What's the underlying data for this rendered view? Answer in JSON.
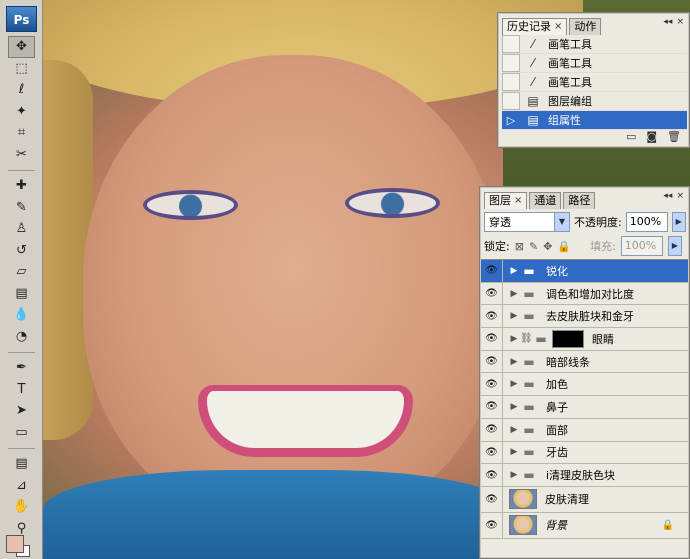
{
  "app": {
    "logo": "Ps"
  },
  "toolbar": {
    "tools": [
      {
        "name": "move-tool",
        "glyph": "✥",
        "selected": true
      },
      {
        "name": "marquee-tool",
        "glyph": "⬚"
      },
      {
        "name": "lasso-tool",
        "glyph": "ℓ"
      },
      {
        "name": "magic-wand-tool",
        "glyph": "✦"
      },
      {
        "name": "crop-tool",
        "glyph": "⌗"
      },
      {
        "name": "slice-tool",
        "glyph": "✂"
      },
      {
        "sep": true
      },
      {
        "name": "healing-brush-tool",
        "glyph": "✚"
      },
      {
        "name": "brush-tool",
        "glyph": "✎"
      },
      {
        "name": "clone-stamp-tool",
        "glyph": "♙"
      },
      {
        "name": "history-brush-tool",
        "glyph": "↺"
      },
      {
        "name": "eraser-tool",
        "glyph": "▱"
      },
      {
        "name": "gradient-tool",
        "glyph": "▤"
      },
      {
        "name": "blur-tool",
        "glyph": "💧"
      },
      {
        "name": "dodge-tool",
        "glyph": "◔"
      },
      {
        "sep": true
      },
      {
        "name": "pen-tool",
        "glyph": "✒"
      },
      {
        "name": "type-tool",
        "glyph": "T"
      },
      {
        "name": "path-selection-tool",
        "glyph": "➤"
      },
      {
        "name": "shape-tool",
        "glyph": "▭"
      },
      {
        "sep": true
      },
      {
        "name": "notes-tool",
        "glyph": "▤"
      },
      {
        "name": "eyedropper-tool",
        "glyph": "⊿"
      },
      {
        "name": "hand-tool",
        "glyph": "✋"
      },
      {
        "name": "zoom-tool",
        "glyph": "⚲"
      }
    ],
    "foreground_color": "#e6c2ae",
    "background_color": "#ffffff"
  },
  "history": {
    "tabs": [
      {
        "label": "历史记录",
        "active": true,
        "closable": true
      },
      {
        "label": "动作",
        "active": false,
        "closable": false
      }
    ],
    "items": [
      {
        "label": "画笔工具",
        "icon": "brush-icon",
        "selected": false
      },
      {
        "label": "画笔工具",
        "icon": "brush-icon",
        "selected": false
      },
      {
        "label": "画笔工具",
        "icon": "brush-icon",
        "selected": false
      },
      {
        "label": "图层编组",
        "icon": "history-state-icon",
        "selected": false
      },
      {
        "label": "组属性",
        "icon": "history-state-icon",
        "selected": true
      }
    ]
  },
  "layers": {
    "tabs": [
      {
        "label": "图层",
        "active": true,
        "closable": true
      },
      {
        "label": "通道",
        "active": false,
        "closable": false
      },
      {
        "label": "路径",
        "active": false,
        "closable": false
      }
    ],
    "blend_mode": "穿透",
    "opacity_label": "不透明度:",
    "opacity_value": "100%",
    "lock_label": "锁定:",
    "fill_label": "填充:",
    "fill_value": "100%",
    "items": [
      {
        "name": "锐化",
        "type": "group",
        "selected": true
      },
      {
        "name": "调色和增加对比度",
        "type": "group",
        "selected": false
      },
      {
        "name": "去皮肤脏块和金牙",
        "type": "group",
        "selected": false
      },
      {
        "name": "眼睛",
        "type": "group-with-mask",
        "selected": false
      },
      {
        "name": "暗部线条",
        "type": "group",
        "selected": false
      },
      {
        "name": "加色",
        "type": "group",
        "selected": false
      },
      {
        "name": "鼻子",
        "type": "group",
        "selected": false
      },
      {
        "name": "面部",
        "type": "group",
        "selected": false
      },
      {
        "name": "牙齿",
        "type": "group",
        "selected": false
      },
      {
        "name": "i清理皮肤色块",
        "type": "group",
        "selected": false
      },
      {
        "name": "皮肤清理",
        "type": "image",
        "selected": false
      },
      {
        "name": "背景",
        "type": "background",
        "selected": false,
        "locked": true
      }
    ]
  }
}
